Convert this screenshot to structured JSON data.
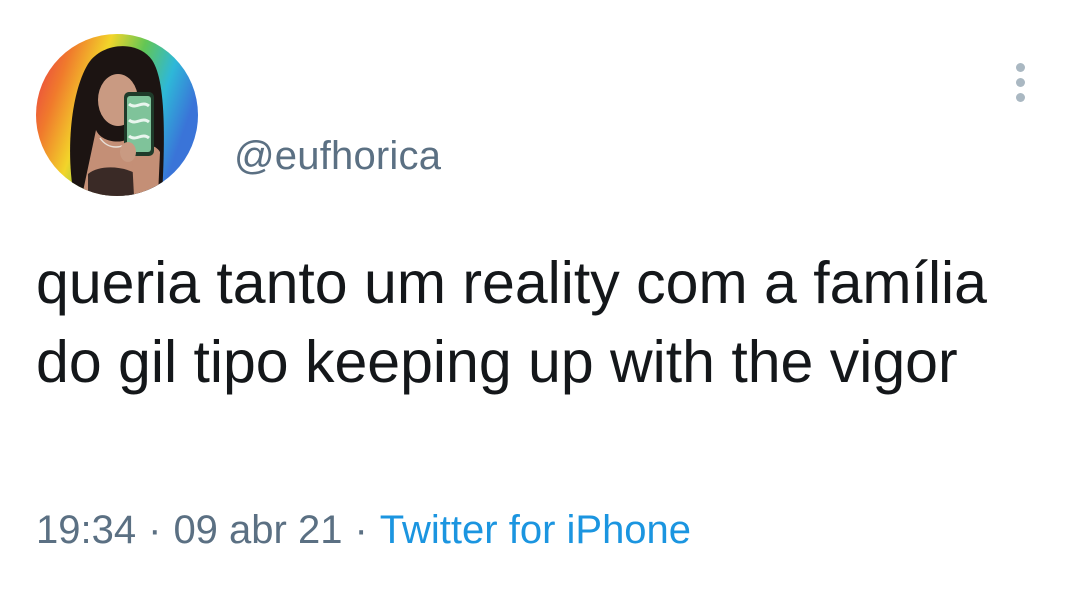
{
  "tweet": {
    "avatar_icon": "profile-photo",
    "handle": "@eufhorica",
    "more_icon": "more-vertical-icon",
    "text": "queria tanto um reality com a família do gil tipo keeping up with the vigor",
    "time": "19:34",
    "date": "09 abr 21",
    "separator": "·",
    "source": "Twitter for iPhone",
    "colors": {
      "text": "#14171a",
      "secondary": "#5b7083",
      "link": "#1b95e0",
      "icon": "#aab8c2"
    }
  }
}
